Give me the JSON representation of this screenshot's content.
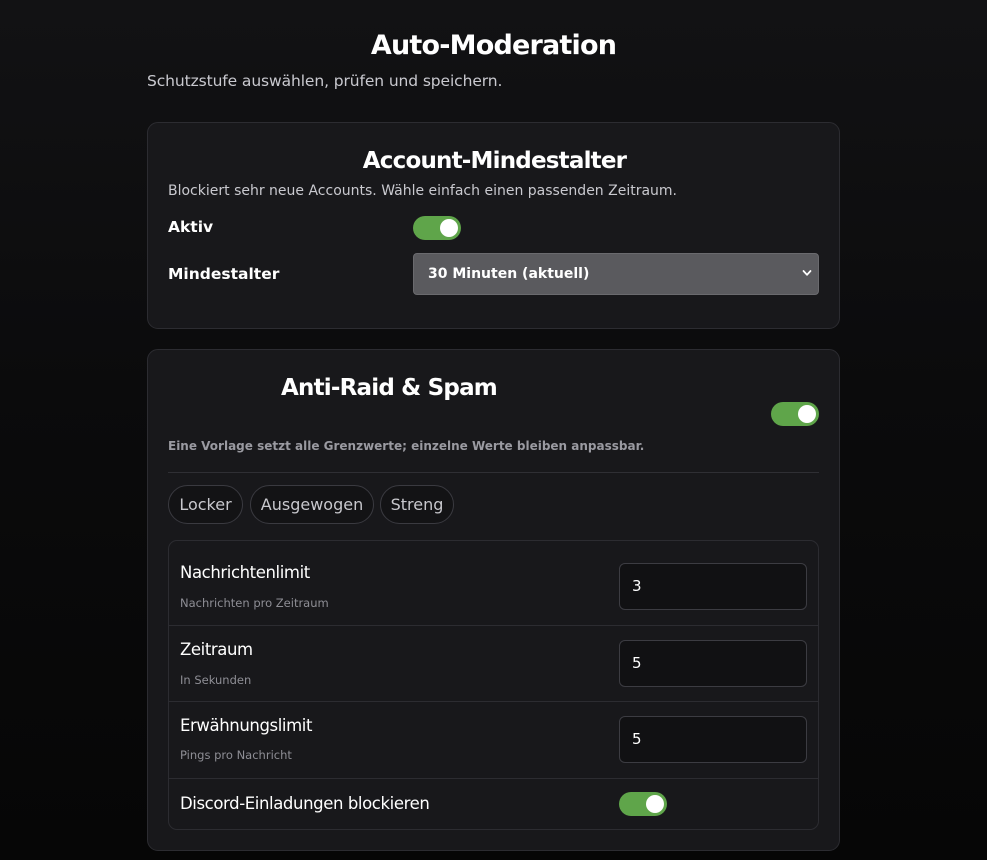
{
  "page": {
    "title": "Auto-Moderation",
    "subtitle": "Schutzstufe auswählen, prüfen und speichern."
  },
  "account_age": {
    "title": "Account-Mindestalter",
    "description": "Blockiert sehr neue Accounts. Wähle einfach einen passenden Zeitraum.",
    "active_label": "Aktiv",
    "active": true,
    "min_age_label": "Mindestalter",
    "min_age_value": "30 Minuten (aktuell)"
  },
  "anti_raid": {
    "title": "Anti-Raid & Spam",
    "enabled": true,
    "description": "Eine Vorlage setzt alle Grenzwerte; einzelne Werte bleiben anpassbar.",
    "presets": [
      "Locker",
      "Ausgewogen",
      "Streng"
    ],
    "settings": [
      {
        "label": "Nachrichtenlimit",
        "hint": "Nachrichten pro Zeitraum",
        "value": "3"
      },
      {
        "label": "Zeitraum",
        "hint": "In Sekunden",
        "value": "5"
      },
      {
        "label": "Erwähnungslimit",
        "hint": "Pings pro Nachricht",
        "value": "5"
      }
    ],
    "invite_block_label": "Discord-Einladungen blockieren",
    "invite_block": true
  },
  "colors": {
    "toggle_on": "#5fa54a",
    "card_bg": "#18181b",
    "select_bg": "#5a5a5e"
  },
  "icons": {
    "select_arrow": "chevron-down-icon"
  }
}
